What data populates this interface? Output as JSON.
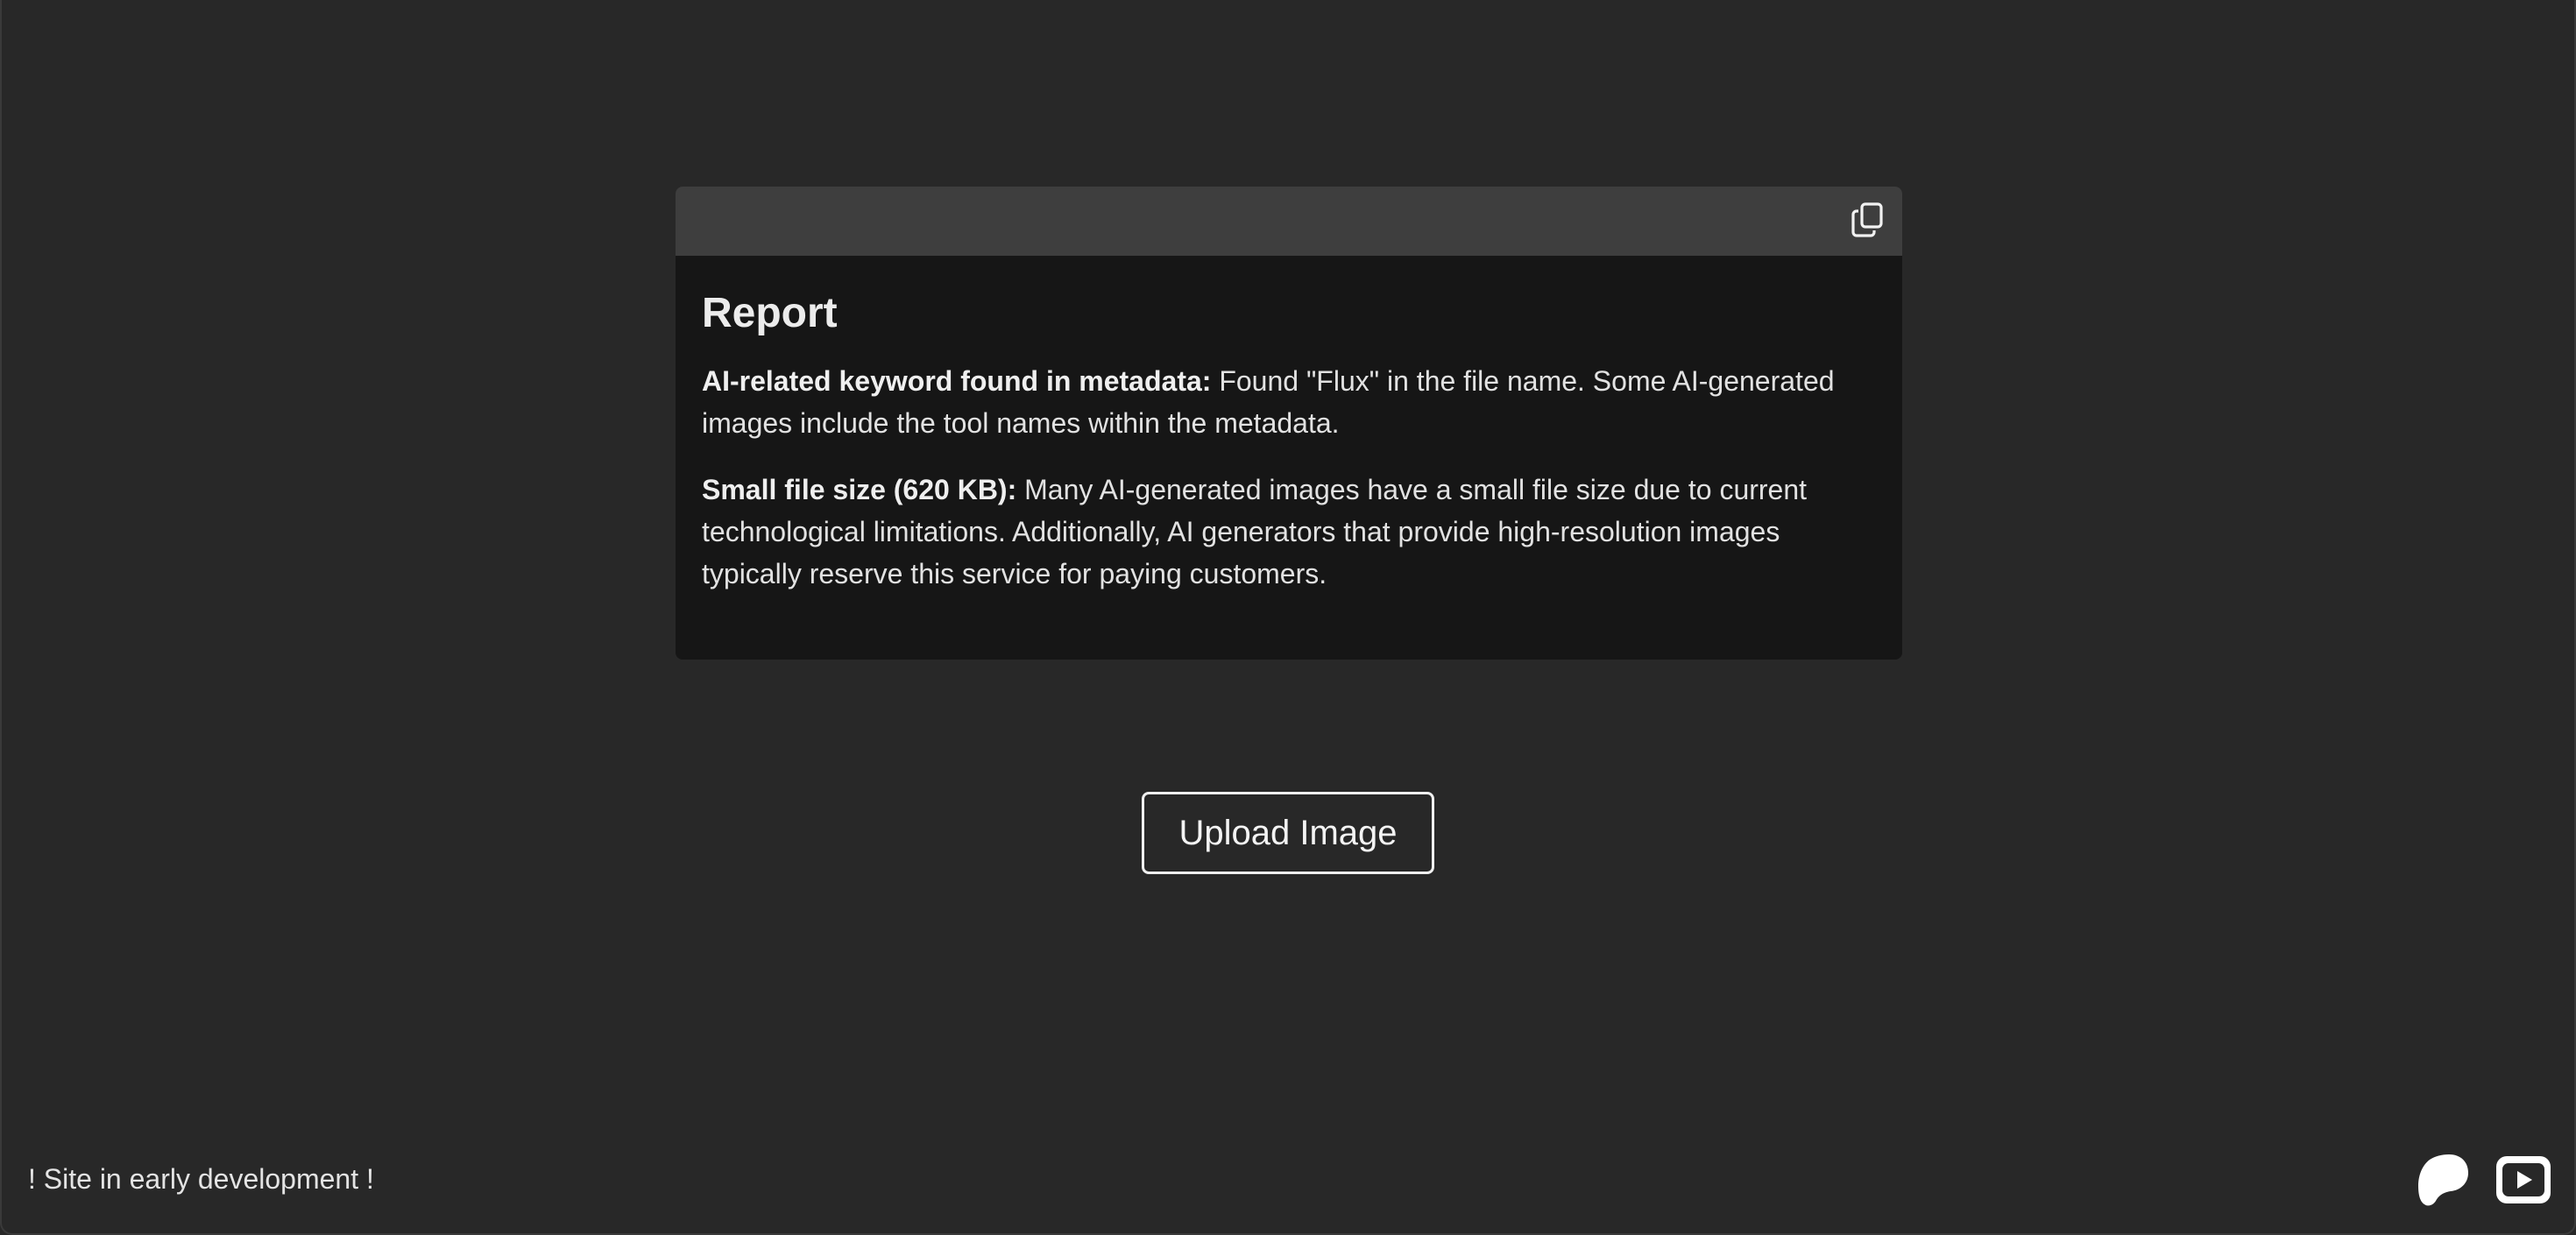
{
  "report": {
    "title": "Report",
    "copy_icon": "copy-icon",
    "findings": [
      {
        "label": "AI-related keyword found in metadata:",
        "text": " Found \"Flux\" in the file name. Some AI-generated images include the tool names within the metadata."
      },
      {
        "label": "Small file size (620 KB):",
        "text": " Many AI-generated images have a small file size due to current technological limitations. Additionally, AI generators that provide high-resolution images typically reserve this service for paying customers."
      }
    ]
  },
  "upload": {
    "label": "Upload Image"
  },
  "footer": {
    "note": "! Site in early development !",
    "social_icons": [
      "patreon-icon",
      "youtube-icon"
    ]
  },
  "colors": {
    "background": "#282828",
    "card_body": "#161616",
    "card_header": "#3e3e3e",
    "text": "#e4e4e4"
  }
}
